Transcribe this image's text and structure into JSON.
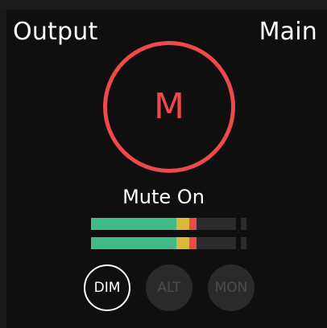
{
  "header": {
    "left_title": "Output",
    "right_title": "Main"
  },
  "mute": {
    "button_letter": "M",
    "status_text": "Mute On",
    "color": "#ef4a4a"
  },
  "meters": [
    {
      "level_fraction": 0.73,
      "green_fraction": 0.59,
      "yellow_fraction": 0.09,
      "red_fraction": 0.05
    },
    {
      "level_fraction": 0.73,
      "green_fraction": 0.59,
      "yellow_fraction": 0.09,
      "red_fraction": 0.05
    }
  ],
  "buttons": {
    "dim": "DIM",
    "alt": "ALT",
    "mon": "MON"
  },
  "colors": {
    "meter_green": "#3fba88",
    "meter_yellow": "#d9b93a",
    "meter_red": "#ef4a4a",
    "background": "#0f0f0f"
  }
}
